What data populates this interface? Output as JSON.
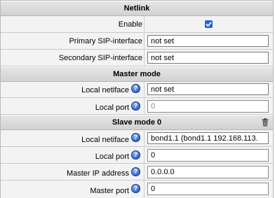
{
  "netlink": {
    "title": "Netlink",
    "enable_label": "Enable",
    "enable_checked": true,
    "primary_label": "Primary SIP-interface",
    "primary_value": "not set",
    "secondary_label": "Secondary SIP-interface",
    "secondary_value": "not set"
  },
  "master": {
    "title": "Master mode",
    "iface_label": "Local netiface",
    "iface_value": "not set",
    "port_label": "Local port",
    "port_value": "0"
  },
  "slave": {
    "title": "Slave mode 0",
    "iface_label": "Local netiface",
    "iface_value": "bond1.1 (bond1.1 192.168.113.7",
    "port_label": "Local port",
    "port_value": "0",
    "master_ip_label": "Master IP address",
    "master_ip_value": "0.0.0.0",
    "master_port_label": "Master port",
    "master_port_value": "0"
  },
  "icons": {
    "help": "help-icon",
    "delete": "trash-icon",
    "help_glyph": "?"
  }
}
